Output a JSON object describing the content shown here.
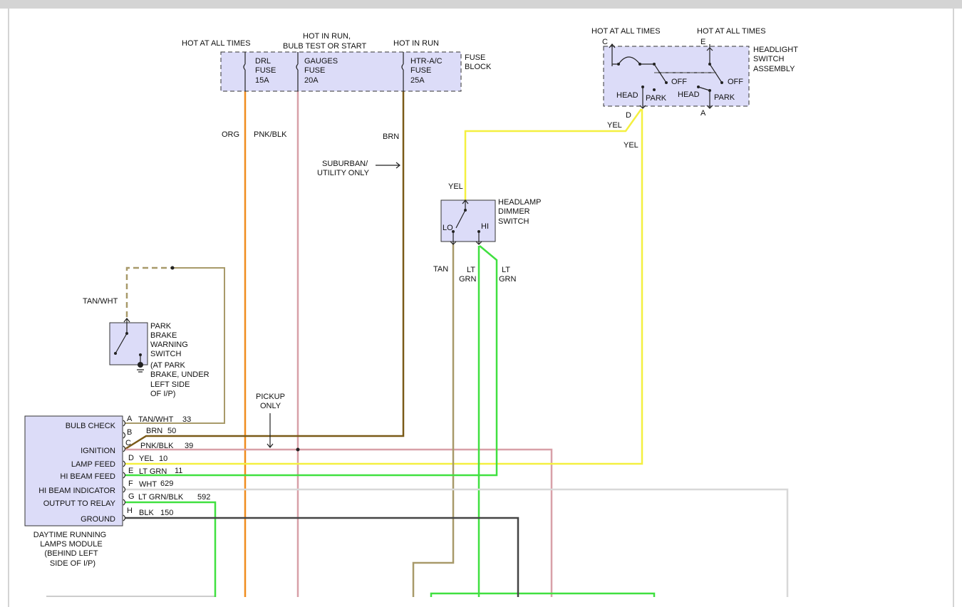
{
  "colors": {
    "org": "#f08c1e",
    "pnk": "#d8a0a8",
    "brn": "#7a5a18",
    "yel": "#f4f040",
    "grn": "#40e040",
    "tan": "#a89a6a",
    "wht": "#d8d8d8",
    "blk": "#444444",
    "box": "#dcdcf8"
  },
  "fuse_block": {
    "label1": "FUSE",
    "label2": "BLOCK",
    "hot1": "HOT AT ALL TIMES",
    "hot2a": "HOT IN RUN,",
    "hot2b": "BULB TEST OR START",
    "hot3": "HOT IN RUN",
    "fuses": [
      {
        "l1": "DRL",
        "l2": "FUSE",
        "l3": "15A"
      },
      {
        "l1": "GAUGES",
        "l2": "FUSE",
        "l3": "20A"
      },
      {
        "l1": "HTR-A/C",
        "l2": "FUSE",
        "l3": "25A"
      }
    ]
  },
  "headlight_switch": {
    "hot_c": "HOT AT ALL TIMES",
    "hot_e": "HOT AT ALL TIMES",
    "l1": "HEADLIGHT",
    "l2": "SWITCH",
    "l3": "ASSEMBLY",
    "pins": {
      "c": "C",
      "e": "E",
      "d": "D",
      "a": "A"
    },
    "off": "OFF",
    "head": "HEAD",
    "park": "PARK"
  },
  "dimmer": {
    "l1": "HEADLAMP",
    "l2": "DIMMER",
    "l3": "SWITCH",
    "lo": "LO",
    "hi": "HI"
  },
  "park_brake": {
    "l1": "PARK",
    "l2": "BRAKE",
    "l3": "WARNING",
    "l4": "SWITCH",
    "n1": "(AT PARK",
    "n2": "BRAKE, UNDER",
    "n3": "LEFT SIDE",
    "n4": "OF I/P)"
  },
  "wire_labels": {
    "org": "ORG",
    "pnkblk": "PNK/BLK",
    "brn": "BRN",
    "suburban1": "SUBURBAN/",
    "suburban2": "UTILITY ONLY",
    "yel1": "YEL",
    "yel2": "YEL",
    "yel3": "YEL",
    "tan": "TAN",
    "ltgrn1a": "LT",
    "ltgrn1b": "GRN",
    "ltgrn2a": "LT",
    "ltgrn2b": "GRN",
    "tanwht": "TAN/WHT",
    "pickup1": "PICKUP",
    "pickup2": "ONLY"
  },
  "module": {
    "name1": "DAYTIME RUNNING",
    "name2": "LAMPS MODULE",
    "name3": "(BEHIND LEFT",
    "name4": "SIDE OF I/P)",
    "pins": [
      {
        "pin": "A",
        "func": "BULB CHECK",
        "wire": "TAN/WHT",
        "circuit": "33"
      },
      {
        "pin": "B",
        "func": "",
        "wire": "BRN",
        "circuit": "50"
      },
      {
        "pin": "C",
        "func": "IGNITION",
        "wire": "PNK/BLK",
        "circuit": "39"
      },
      {
        "pin": "D",
        "func": "LAMP FEED",
        "wire": "YEL",
        "circuit": "10"
      },
      {
        "pin": "E",
        "func": "HI BEAM FEED",
        "wire": "LT GRN",
        "circuit": "11"
      },
      {
        "pin": "F",
        "func": "HI BEAM INDICATOR",
        "wire": "WHT",
        "circuit": "629"
      },
      {
        "pin": "G",
        "func": "OUTPUT TO RELAY",
        "wire": "LT GRN/BLK",
        "circuit": "592"
      },
      {
        "pin": "H",
        "func": "GROUND",
        "wire": "BLK",
        "circuit": "150"
      }
    ]
  }
}
